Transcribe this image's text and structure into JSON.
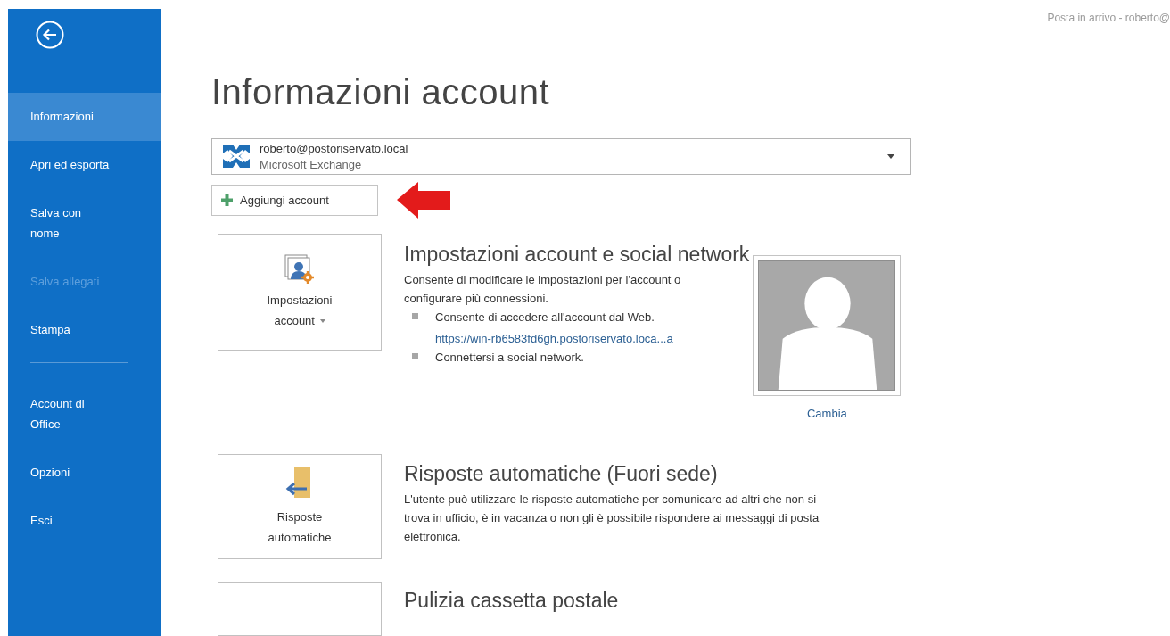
{
  "window": {
    "title": "Posta in arrivo - roberto@"
  },
  "sidebar": {
    "items": [
      {
        "kind": "item",
        "label": "Informazioni",
        "selected": true,
        "disabled": false
      },
      {
        "kind": "item",
        "label": "Apri ed esporta",
        "selected": false,
        "disabled": false
      },
      {
        "kind": "item",
        "label": "Salva con\nnome",
        "selected": false,
        "disabled": false
      },
      {
        "kind": "item",
        "label": "Salva allegati",
        "selected": false,
        "disabled": true
      },
      {
        "kind": "item",
        "label": "Stampa",
        "selected": false,
        "disabled": false
      },
      {
        "kind": "separator"
      },
      {
        "kind": "item",
        "label": "Account di\nOffice",
        "selected": false,
        "disabled": false
      },
      {
        "kind": "item",
        "label": "Opzioni",
        "selected": false,
        "disabled": false
      },
      {
        "kind": "item",
        "label": "Esci",
        "selected": false,
        "disabled": false
      }
    ]
  },
  "page_title": "Informazioni account",
  "account_selector": {
    "address": "roberto@postoriservato.local",
    "type": "Microsoft Exchange"
  },
  "add_account_button": "Aggiungi account",
  "sections": [
    {
      "kind": "settings",
      "button_label": "Impostazioni account",
      "button_menu": true,
      "heading": "Impostazioni account e social network",
      "description": "Consente di modificare le impostazioni per l'account o configurare più connessioni.",
      "bullets": [
        {
          "text": "Consente di accedere all'account dal Web.",
          "link": "https://win-rb6583fd6gh.postoriservato.loca...a"
        },
        {
          "text": "Connettersi a social network."
        }
      ],
      "photo": {
        "action": "Cambia"
      }
    },
    {
      "kind": "auto-reply",
      "button_label": "Risposte automatiche",
      "button_menu": false,
      "heading": "Risposte automatiche (Fuori sede)",
      "description": "L'utente può utilizzare le risposte automatiche per comunicare ad altri che non si trova in ufficio, è in vacanza o non gli è possibile rispondere ai messaggi di posta elettronica."
    },
    {
      "kind": "cleanup",
      "heading": "Pulizia cassetta postale"
    }
  ]
}
